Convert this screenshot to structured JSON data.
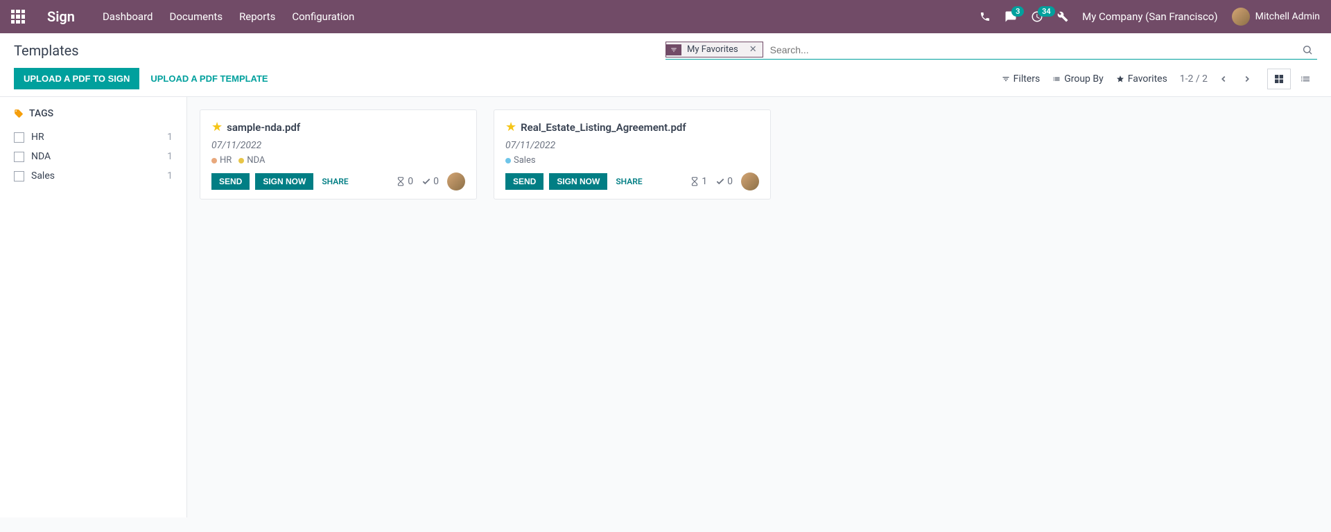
{
  "topbar": {
    "brand": "Sign",
    "nav": [
      "Dashboard",
      "Documents",
      "Reports",
      "Configuration"
    ],
    "messages_count": "3",
    "activities_count": "34",
    "company": "My Company (San Francisco)",
    "user": "Mitchell Admin"
  },
  "page": {
    "title": "Templates",
    "filter_chip": "My Favorites",
    "search_placeholder": "Search...",
    "upload_sign": "UPLOAD A PDF TO SIGN",
    "upload_template": "UPLOAD A PDF TEMPLATE",
    "filters_label": "Filters",
    "groupby_label": "Group By",
    "favorites_label": "Favorites",
    "pager": "1-2 / 2"
  },
  "sidebar": {
    "header": "TAGS",
    "tags": [
      {
        "label": "HR",
        "count": "1"
      },
      {
        "label": "NDA",
        "count": "1"
      },
      {
        "label": "Sales",
        "count": "1"
      }
    ]
  },
  "cards": [
    {
      "title": "sample-nda.pdf",
      "date": "07/11/2022",
      "tags": [
        {
          "label": "HR",
          "color": "#e8a87c"
        },
        {
          "label": "NDA",
          "color": "#e8c547"
        }
      ],
      "send": "SEND",
      "sign_now": "SIGN NOW",
      "share": "SHARE",
      "pending": "0",
      "signed": "0"
    },
    {
      "title": "Real_Estate_Listing_Agreement.pdf",
      "date": "07/11/2022",
      "tags": [
        {
          "label": "Sales",
          "color": "#6ec5e9"
        }
      ],
      "send": "SEND",
      "sign_now": "SIGN NOW",
      "share": "SHARE",
      "pending": "1",
      "signed": "0"
    }
  ]
}
